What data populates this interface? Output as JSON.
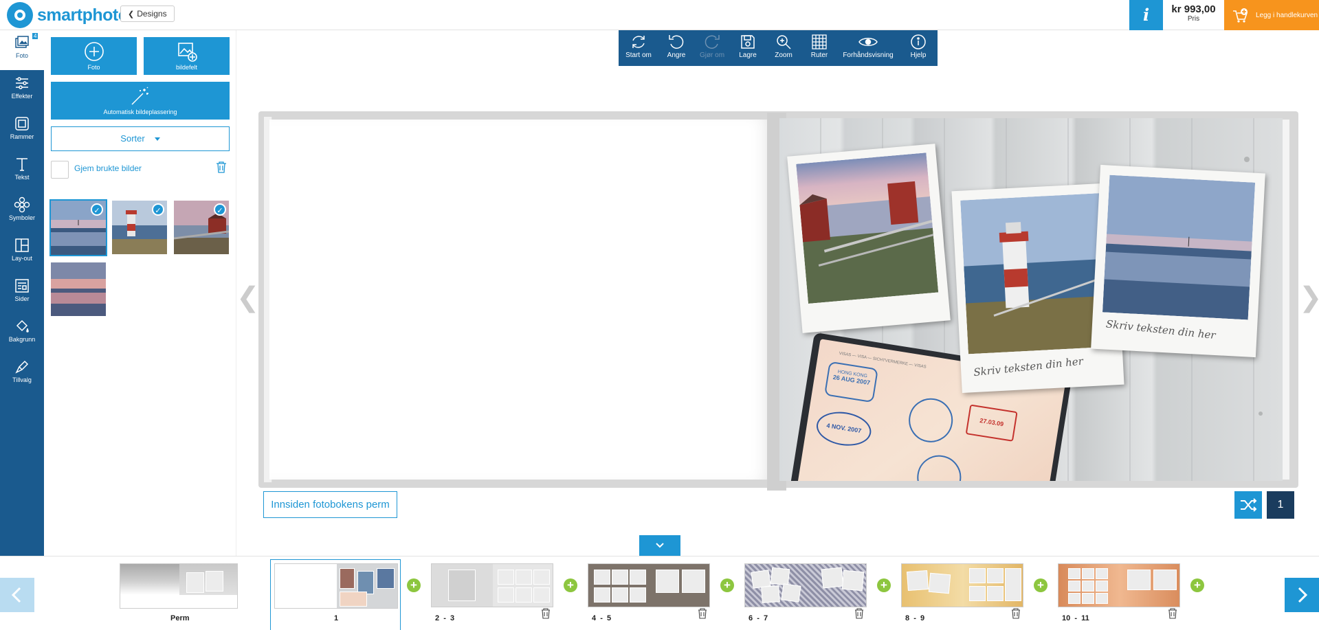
{
  "header": {
    "brand": "smartphoto",
    "designs_label": "Designs",
    "info_label": "i",
    "price": "kr 993,00",
    "price_label": "Pris",
    "cart_label": "Legg i handlekurven"
  },
  "sidebar": {
    "items": [
      {
        "label": "Foto",
        "badge": "4"
      },
      {
        "label": "Effekter"
      },
      {
        "label": "Rammer"
      },
      {
        "label": "Tekst"
      },
      {
        "label": "Symboler"
      },
      {
        "label": "Lay-out"
      },
      {
        "label": "Sider"
      },
      {
        "label": "Bakgrunn"
      },
      {
        "label": "Tillvalg"
      }
    ]
  },
  "panel": {
    "add_photo_label": "Foto",
    "add_frame_label": "bildefelt",
    "auto_place_label": "Automatisk bildeplassering",
    "sort_label": "Sorter",
    "hide_used_label": "Gjem brukte bilder"
  },
  "toolbar": {
    "items": [
      {
        "label": "Start om",
        "icon": "restart-icon",
        "enabled": true
      },
      {
        "label": "Angre",
        "icon": "undo-icon",
        "enabled": true
      },
      {
        "label": "Gjør om",
        "icon": "redo-icon",
        "enabled": false
      },
      {
        "label": "Lagre",
        "icon": "save-icon",
        "enabled": true
      },
      {
        "label": "Zoom",
        "icon": "zoom-icon",
        "enabled": true
      },
      {
        "label": "Ruter",
        "icon": "grid-icon",
        "enabled": true
      },
      {
        "label": "Forhåndsvisning",
        "icon": "eye-icon",
        "enabled": true
      },
      {
        "label": "Hjelp",
        "icon": "help-icon",
        "enabled": true
      }
    ]
  },
  "canvas": {
    "caption_1": "Skriv teksten din her",
    "caption_2": "Skriv teksten din her",
    "stamp_1": "HONG KONG",
    "stamp_2": "26 AUG 2007",
    "stamp_3": "4 NOV. 2007",
    "stamp_4": "27.03.09",
    "passport_header": "VISAS — VISA — SICHTVERMERKE — VISAS"
  },
  "footer_main": {
    "cover_label": "Innsiden fotobokens perm",
    "page_number": "1"
  },
  "filmstrip": {
    "spreads": [
      {
        "label": "Perm"
      },
      {
        "label": "1"
      },
      {
        "label": "2  -  3"
      },
      {
        "label": "4  -  5"
      },
      {
        "label": "6  -  7"
      },
      {
        "label": "8  -  9"
      },
      {
        "label": "10  -  11"
      }
    ],
    "add_symbol": "+"
  },
  "colors": {
    "accent": "#1e96d4",
    "sidebar": "#1a5a8e",
    "cart": "#f7941d",
    "add": "#8dc63f"
  }
}
